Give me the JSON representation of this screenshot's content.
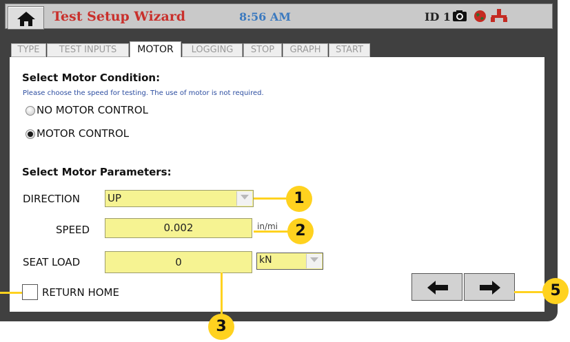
{
  "header": {
    "title": "Test Setup Wizard",
    "time": "8:56 AM",
    "id_label": "ID 1"
  },
  "tabs": [
    {
      "label": "TYPE"
    },
    {
      "label": "TEST INPUTS"
    },
    {
      "label": "MOTOR"
    },
    {
      "label": "LOGGING"
    },
    {
      "label": "STOP"
    },
    {
      "label": "GRAPH"
    },
    {
      "label": "START"
    }
  ],
  "active_tab": "MOTOR",
  "motor_condition": {
    "heading": "Select Motor Condition:",
    "note": "Please choose the speed for testing.  The use of motor is not required.",
    "options": [
      {
        "label": "NO MOTOR CONTROL",
        "selected": false
      },
      {
        "label": "MOTOR CONTROL",
        "selected": true
      }
    ]
  },
  "motor_parameters": {
    "heading": "Select Motor Parameters:",
    "direction": {
      "label": "DIRECTION",
      "value": "UP"
    },
    "speed": {
      "label": "SPEED",
      "value": "0.002",
      "unit": "in/mi"
    },
    "seat_load": {
      "label": "SEAT LOAD",
      "value": "0",
      "unit": "kN"
    },
    "return_home": {
      "label": "RETURN HOME",
      "checked": false
    }
  },
  "callouts": [
    "1",
    "2",
    "3",
    "5"
  ],
  "colors": {
    "title_red": "#c9302c",
    "clock_blue": "#3a79bf",
    "field_yellow": "#f6f392",
    "callout_yellow": "#ffd21f",
    "device_frame": "#404040"
  },
  "icons": [
    "home-icon",
    "camera-icon",
    "globe-icon",
    "network-icon",
    "arrow-left-icon",
    "arrow-right-icon",
    "dropdown-arrow-icon"
  ]
}
